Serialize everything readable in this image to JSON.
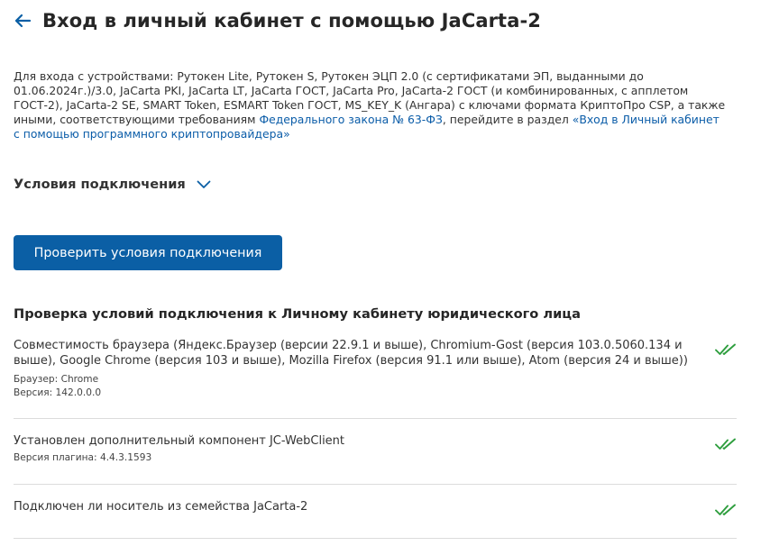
{
  "header": {
    "title": "Вход в личный кабинет с помощью JaCarta-2",
    "back_icon": "arrow-left-icon"
  },
  "intro": {
    "text_before_link": "Для входа с устройствами: Рутокен Lite, Рутокен S, Рутокен ЭЦП 2.0 (с сертификатами ЭП, выданными до 01.06.2024г.)/3.0, JaCarta PKI, JaCarta LT, JaCarta ГОСТ, JaCarta Pro, JaCarta-2 ГОСТ (и комбинированных, с апплетом ГОСТ-2), JaCarta-2 SE, SMART Token, ESMART Token ГОСТ, MS_KEY_K (Ангара) с ключами формата КриптоПро CSP, а также иными, соответствующими требованиям ",
    "law_link": "Федерального закона № 63-ФЗ",
    "text_between": ", перейдите в раздел ",
    "section_link": "«Вход в Личный кабинет с помощью программного криптопровайдера»"
  },
  "conditions": {
    "label": "Условия подключения",
    "icon": "chevron-down-icon"
  },
  "check_button": {
    "label": "Проверить условия подключения"
  },
  "results": {
    "title": "Проверка условий подключения к Личному кабинету юридического лица",
    "items": [
      {
        "text": "Совместимость браузера (Яндекс.Браузер (версии 22.9.1 и выше), Chromium-Gost (версия 103.0.5060.134 и выше), Google Chrome (версия 103 и выше), Mozilla Firefox (версия 91.1 или выше), Atom (версия 24 и выше))",
        "details": [
          "Браузер: Chrome",
          "Версия: 142.0.0.0"
        ],
        "status_icon": "double-check-icon"
      },
      {
        "text": "Установлен дополнительный компонент JC-WebClient",
        "details": [
          "Версия плагина: 4.4.3.1593"
        ],
        "status_icon": "double-check-icon"
      },
      {
        "text": "Подключен ли носитель из семейства JaCarta-2",
        "details": [],
        "status_icon": "double-check-icon"
      }
    ]
  },
  "colors": {
    "accent": "#0b5fa5",
    "link": "#0a5ca8",
    "success": "#2e9e3e"
  }
}
